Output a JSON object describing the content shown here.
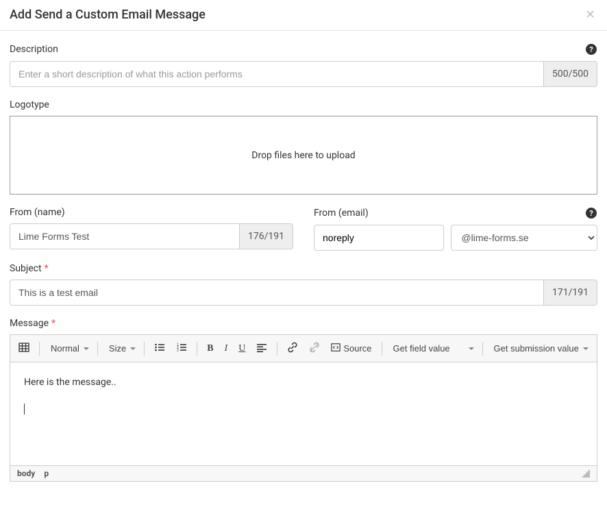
{
  "modal": {
    "title": "Add Send a Custom Email Message"
  },
  "description": {
    "label": "Description",
    "placeholder": "Enter a short description of what this action performs",
    "counter": "500/500"
  },
  "logotype": {
    "label": "Logotype",
    "dropzone_text": "Drop files here to upload"
  },
  "from_name": {
    "label": "From (name)",
    "value": "Lime Forms Test",
    "counter": "176/191"
  },
  "from_email": {
    "label": "From (email)",
    "local_value": "noreply",
    "domain_selected": "@lime-forms.se"
  },
  "subject": {
    "label": "Subject",
    "value": "This is a test email",
    "counter": "171/191"
  },
  "message": {
    "label": "Message",
    "toolbar": {
      "format": "Normal",
      "size": "Size",
      "source": "Source",
      "get_field": "Get field value",
      "get_submission": "Get submission value"
    },
    "content": "Here is the message..",
    "path_body": "body",
    "path_p": "p"
  }
}
